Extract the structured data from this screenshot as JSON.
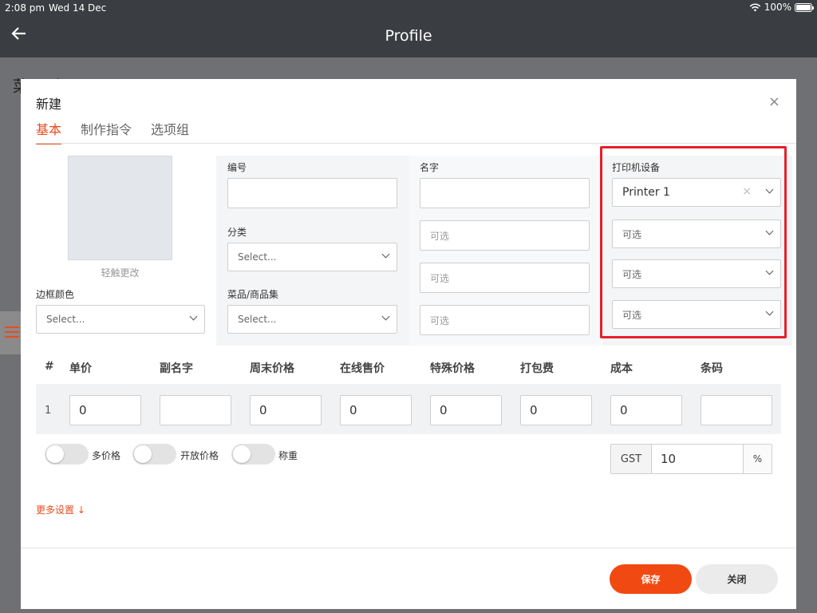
{
  "status": {
    "time": "2:08 pm",
    "date": "Wed 14 Dec",
    "battery": "100%"
  },
  "header": {
    "title": "Profile"
  },
  "background": {
    "title": "菜品/商品"
  },
  "modal": {
    "title": "新建",
    "close_icon": "×",
    "tabs": [
      {
        "label": "基本",
        "active": true
      },
      {
        "label": "制作指令",
        "active": false
      },
      {
        "label": "选项组",
        "active": false
      }
    ],
    "image_caption": "轻触更改",
    "border_color": {
      "label": "边框颜色",
      "placeholder": "Select..."
    },
    "code": {
      "label": "编号",
      "value": ""
    },
    "category": {
      "label": "分类",
      "placeholder": "Select..."
    },
    "item_set": {
      "label": "菜品/商品集",
      "placeholder": "Select..."
    },
    "name": {
      "label": "名字",
      "value": "",
      "optional": [
        "可选",
        "可选",
        "可选"
      ]
    },
    "printer": {
      "label": "打印机设备",
      "selected": "Printer 1",
      "clear": "×",
      "optional": [
        "可选",
        "可选",
        "可选"
      ]
    },
    "table": {
      "columns": [
        "#",
        "单价",
        "副名字",
        "周末价格",
        "在线售价",
        "特殊价格",
        "打包费",
        "成本",
        "条码"
      ],
      "rows": [
        {
          "num": "1",
          "values": [
            "0",
            "",
            "0",
            "0",
            "0",
            "0",
            "0",
            ""
          ]
        }
      ]
    },
    "toggles": [
      {
        "label": "多价格",
        "on": false
      },
      {
        "label": "开放价格",
        "on": false
      },
      {
        "label": "称重",
        "on": false
      }
    ],
    "gst": {
      "prefix": "GST",
      "value": "10",
      "suffix": "%"
    },
    "more_settings": "更多设置 ↓",
    "save_label": "保存",
    "close_label": "关闭"
  },
  "colors": {
    "accent": "#e84c1e",
    "highlight": "#e5202a",
    "header_bg": "#3a3d41"
  }
}
